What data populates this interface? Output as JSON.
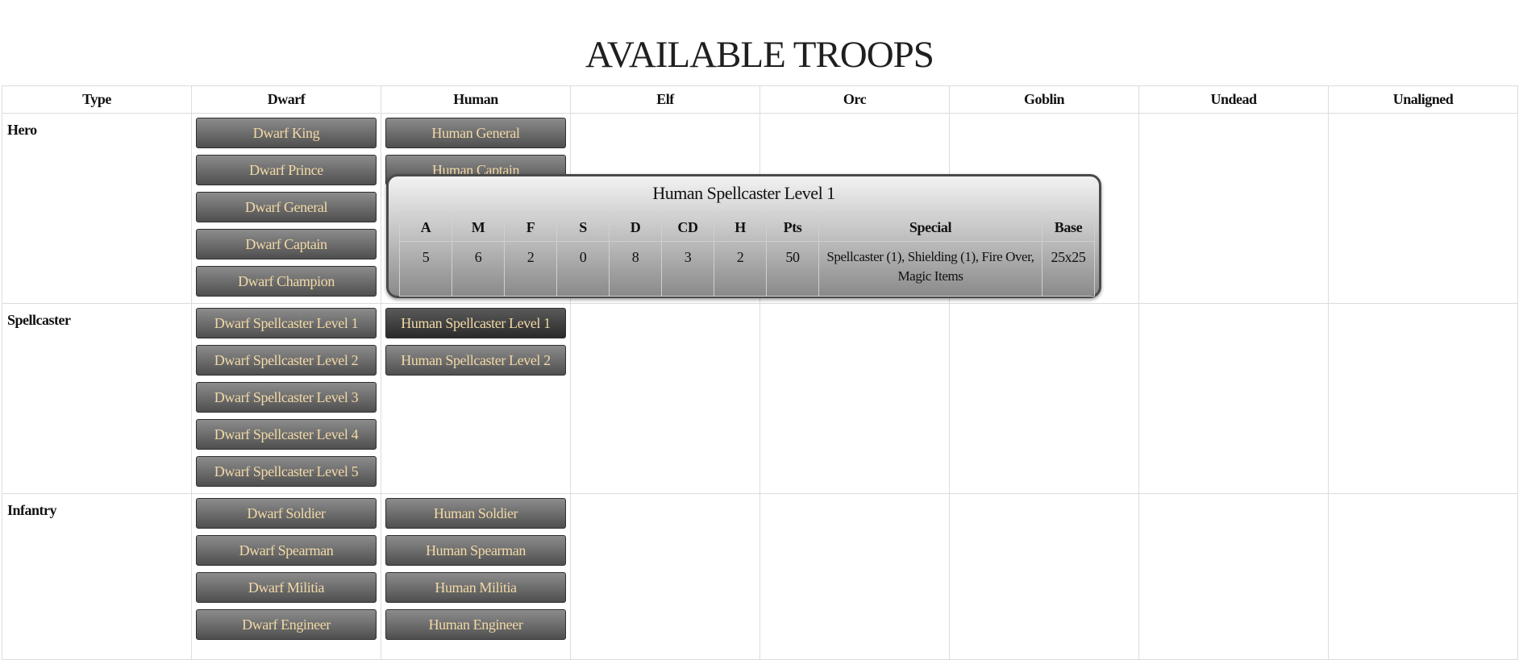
{
  "page": {
    "title": "AVAILABLE TROOPS"
  },
  "table": {
    "headers": [
      "Type",
      "Dwarf",
      "Human",
      "Elf",
      "Orc",
      "Goblin",
      "Undead",
      "Unaligned"
    ],
    "rows": [
      {
        "type": "Hero",
        "dwarf": [
          "Dwarf King",
          "Dwarf Prince",
          "Dwarf General",
          "Dwarf Captain",
          "Dwarf Champion"
        ],
        "human": [
          "Human General",
          "Human Captain"
        ]
      },
      {
        "type": "Spellcaster",
        "dwarf": [
          "Dwarf Spellcaster Level 1",
          "Dwarf Spellcaster Level 2",
          "Dwarf Spellcaster Level 3",
          "Dwarf Spellcaster Level 4",
          "Dwarf Spellcaster Level 5"
        ],
        "human": [
          "Human Spellcaster Level 1",
          "Human Spellcaster Level 2"
        ]
      },
      {
        "type": "Infantry",
        "dwarf": [
          "Dwarf Soldier",
          "Dwarf Spearman",
          "Dwarf Militia",
          "Dwarf Engineer"
        ],
        "human": [
          "Human Soldier",
          "Human Spearman",
          "Human Militia",
          "Human Engineer"
        ]
      }
    ]
  },
  "popup": {
    "title": "Human Spellcaster Level 1",
    "headers": [
      "A",
      "M",
      "F",
      "S",
      "D",
      "CD",
      "H",
      "Pts",
      "Special",
      "Base"
    ],
    "values": [
      "5",
      "6",
      "2",
      "0",
      "8",
      "3",
      "2",
      "50",
      "Spellcaster (1), Shielding (1), Fire Over, Magic Items",
      "25x25"
    ]
  },
  "colors": {
    "button_text": "#f2d9a6",
    "button_top": "#8c8c8c",
    "button_bottom": "#4f4f4f",
    "grid_border": "#dcdcdc"
  }
}
